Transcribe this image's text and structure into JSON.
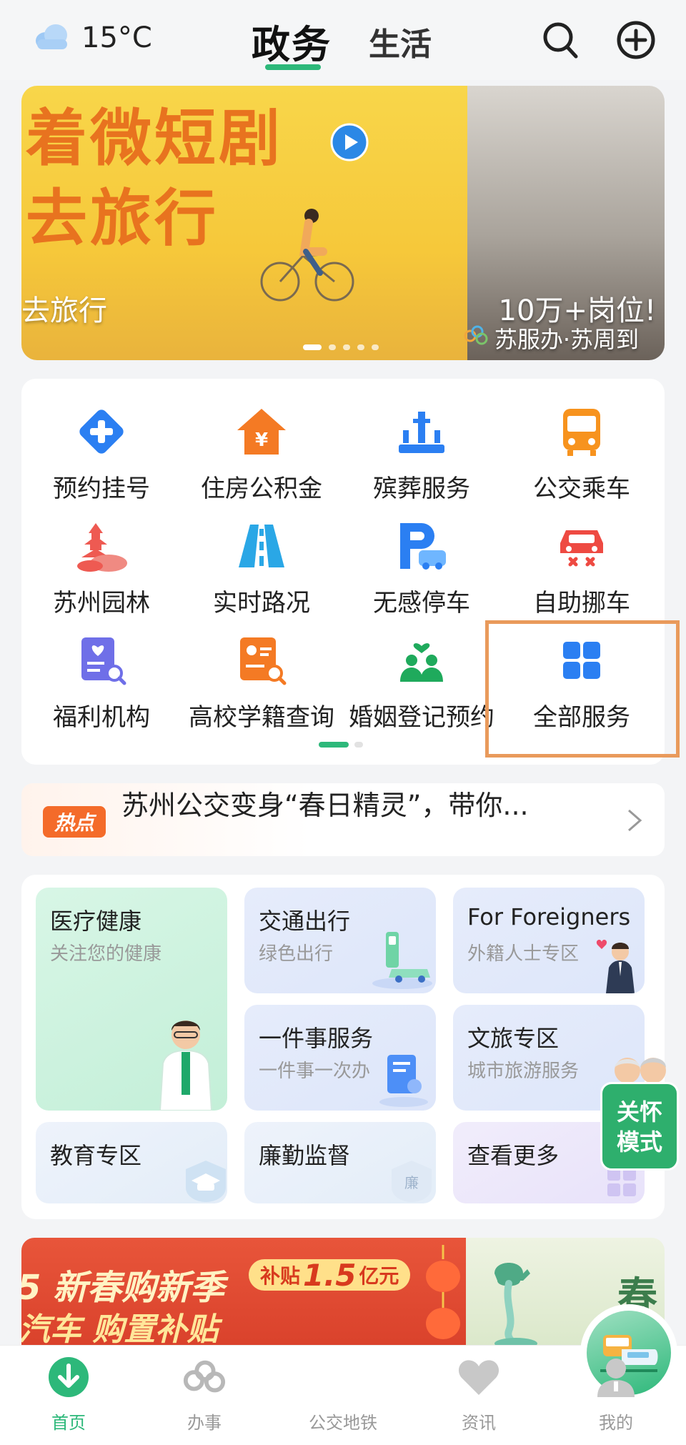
{
  "header": {
    "temperature": "15°C",
    "weather_icon": "cloud-icon",
    "tabs": [
      {
        "label": "政务",
        "active": true
      },
      {
        "label": "生活",
        "active": false
      }
    ],
    "search_icon": "search-icon",
    "add_icon": "plus-circle-icon"
  },
  "banner": {
    "title_line1": "着微短剧",
    "title_line2": "去旅行",
    "subtitle": "去旅行",
    "right_text": "10万+岗位!",
    "source": "苏服办·苏周到",
    "slide_count": 5,
    "active_slide": 1
  },
  "services": {
    "items": [
      {
        "label": "预约挂号",
        "icon": "medical-cross-icon",
        "color": "#2b7ff2"
      },
      {
        "label": "住房公积金",
        "icon": "house-yuan-icon",
        "color": "#f47a24"
      },
      {
        "label": "殡葬服务",
        "icon": "memorial-icon",
        "color": "#2b7ff2"
      },
      {
        "label": "公交乘车",
        "icon": "bus-icon",
        "color": "#f7931e"
      },
      {
        "label": "苏州园林",
        "icon": "pagoda-icon",
        "color": "#ee5a52"
      },
      {
        "label": "实时路况",
        "icon": "road-icon",
        "color": "#2aa7e6"
      },
      {
        "label": "无感停车",
        "icon": "parking-icon",
        "color": "#2b7ff2"
      },
      {
        "label": "自助挪车",
        "icon": "car-move-icon",
        "color": "#ee4a42"
      },
      {
        "label": "福利机构",
        "icon": "welfare-doc-icon",
        "color": "#6f6fe8"
      },
      {
        "label": "高校学籍查询",
        "icon": "student-search-icon",
        "color": "#f47a24"
      },
      {
        "label": "婚姻登记预约",
        "icon": "marriage-icon",
        "color": "#1faa5c"
      },
      {
        "label": "全部服务",
        "icon": "grid-icon",
        "color": "#2b7ff2"
      }
    ],
    "page_count": 2,
    "active_page": 1
  },
  "hot": {
    "badge": "热点",
    "text": "苏州公交变身“春日精灵”，带你..."
  },
  "zones": {
    "medical": {
      "title": "医疗健康",
      "subtitle": "关注您的健康"
    },
    "traffic": {
      "title": "交通出行",
      "subtitle": "绿色出行"
    },
    "foreigners": {
      "title": "For Foreigners",
      "subtitle": "外籍人士专区"
    },
    "one_thing": {
      "title": "一件事服务",
      "subtitle": "一件事一次办"
    },
    "culture": {
      "title": "文旅专区",
      "subtitle": "城市旅游服务"
    },
    "education": {
      "title": "教育专区"
    },
    "integrity": {
      "title": "廉勤监督",
      "badge": "廉"
    },
    "more": {
      "title": "查看更多"
    },
    "care_mode": {
      "line1": "关怀",
      "line2": "模式"
    }
  },
  "promo": {
    "line1": "5 新春购新季",
    "line2": "汽车 购置补贴",
    "subsidy_prefix": "补贴",
    "subsidy_amount": "1.5",
    "subsidy_unit": "亿元",
    "right_text": "春"
  },
  "bottom_nav": [
    {
      "label": "首页",
      "icon": "download-circle-icon",
      "active": true
    },
    {
      "label": "办事",
      "icon": "su-logo-icon",
      "active": false
    },
    {
      "label": "公交地铁",
      "icon": "train-icon",
      "active": false
    },
    {
      "label": "资讯",
      "icon": "heart-icon",
      "active": false
    },
    {
      "label": "我的",
      "icon": "person-icon",
      "active": false
    }
  ],
  "colors": {
    "accent": "#2db87a",
    "hot_badge": "#f46b2a",
    "highlight": "#e99a5b"
  }
}
